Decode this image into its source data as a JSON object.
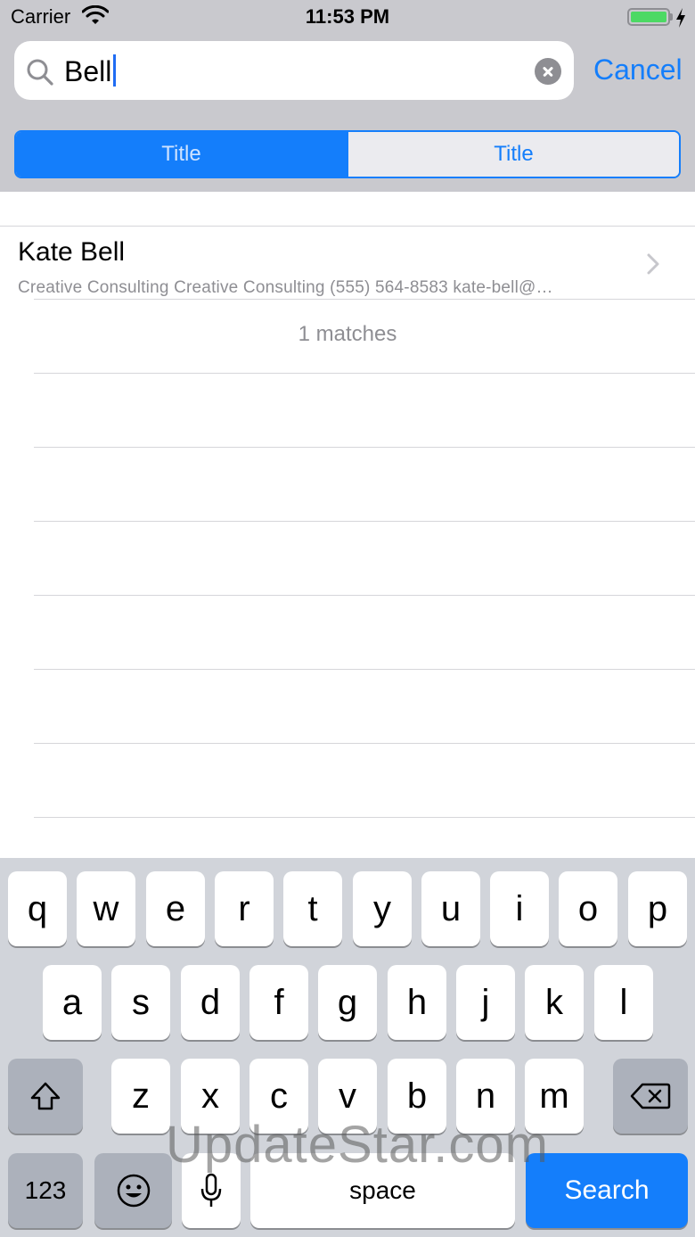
{
  "status_bar": {
    "carrier": "Carrier",
    "time": "11:53 PM",
    "wifi_icon": "wifi-icon",
    "battery_icon": "battery-icon",
    "charging_icon": "bolt-icon",
    "battery_level": 1.0
  },
  "search": {
    "value": "Bell",
    "search_icon": "search-icon",
    "clear_icon": "clear-icon",
    "cancel_label": "Cancel"
  },
  "scope_bar": {
    "segments": [
      {
        "label": "Title",
        "selected": true
      },
      {
        "label": "Title",
        "selected": false
      }
    ]
  },
  "results": {
    "rows": [
      {
        "title": "Kate Bell",
        "subtitle": "Creative Consulting Creative Consulting (555) 564-8583 kate-bell@…",
        "accessory": "chevron-right-icon"
      }
    ],
    "footer": "1 matches"
  },
  "keyboard": {
    "row1": [
      "q",
      "w",
      "e",
      "r",
      "t",
      "y",
      "u",
      "i",
      "o",
      "p"
    ],
    "row2": [
      "a",
      "s",
      "d",
      "f",
      "g",
      "h",
      "j",
      "k",
      "l"
    ],
    "row3": [
      "z",
      "x",
      "c",
      "v",
      "b",
      "n",
      "m"
    ],
    "shift_icon": "shift-icon",
    "delete_icon": "delete-icon",
    "numbers_label": "123",
    "emoji_icon": "emoji-icon",
    "mic_icon": "microphone-icon",
    "space_label": "space",
    "search_label": "Search"
  },
  "watermark": "UpdateStar.com",
  "colors": {
    "accent": "#147efb",
    "header_bg": "#c9c9ce",
    "keyboard_bg": "#d1d4da",
    "battery": "#4cd964"
  }
}
